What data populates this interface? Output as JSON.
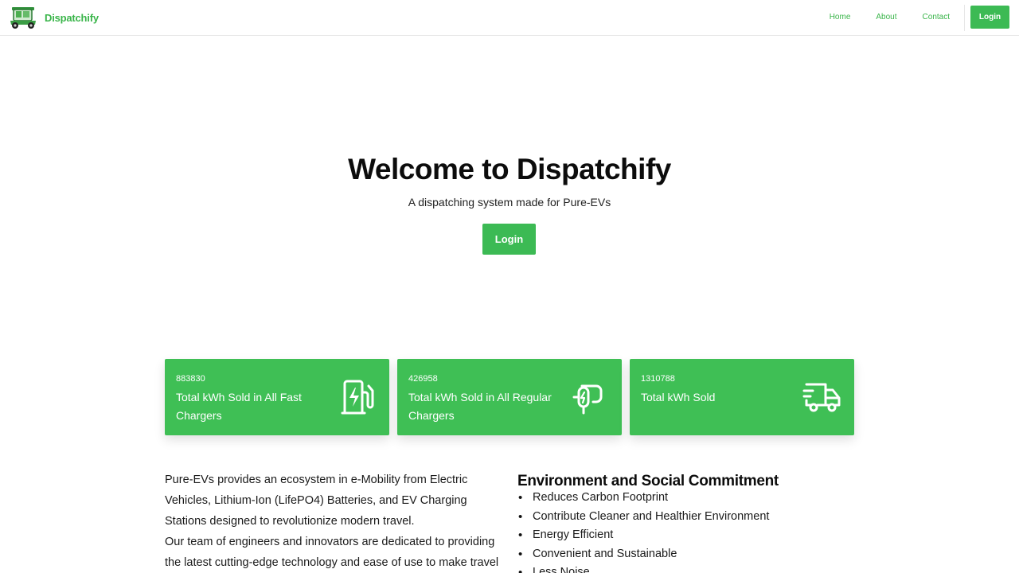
{
  "nav": {
    "brand": "Dispatchify",
    "links": [
      "Home",
      "About",
      "Contact"
    ],
    "login": "Login"
  },
  "hero": {
    "title": "Welcome to Dispatchify",
    "subtitle": "A dispatching system made for Pure-EVs",
    "button": "Login"
  },
  "stats": [
    {
      "value": "883830",
      "label": "Total kWh Sold in All Fast Chargers",
      "icon": "fuel-pump-bolt-icon"
    },
    {
      "value": "426958",
      "label": "Total kWh Sold in All Regular Chargers",
      "icon": "charging-plug-icon"
    },
    {
      "value": "1310788",
      "label": "Total kWh Sold",
      "icon": "fast-truck-icon"
    }
  ],
  "about": {
    "paragraph1": "Pure-EVs provides an ecosystem in e-Mobility from Electric Vehicles, Lithium-Ion (LifePO4) Batteries, and EV Charging Stations designed to revolutionize modern travel.",
    "paragraph2": "Our team of engineers and innovators are dedicated to providing the latest cutting-edge technology and ease of use to make travel easier,"
  },
  "commitment": {
    "title": "Environment and Social Commitment",
    "items": [
      "Reduces Carbon Footprint",
      "Contribute Cleaner and Healthier Environment",
      "Energy Efficient",
      "Convenient and Sustainable",
      "Less Noise"
    ]
  },
  "colors": {
    "brand_green": "#3cba54",
    "card_green": "#3fbf55"
  }
}
